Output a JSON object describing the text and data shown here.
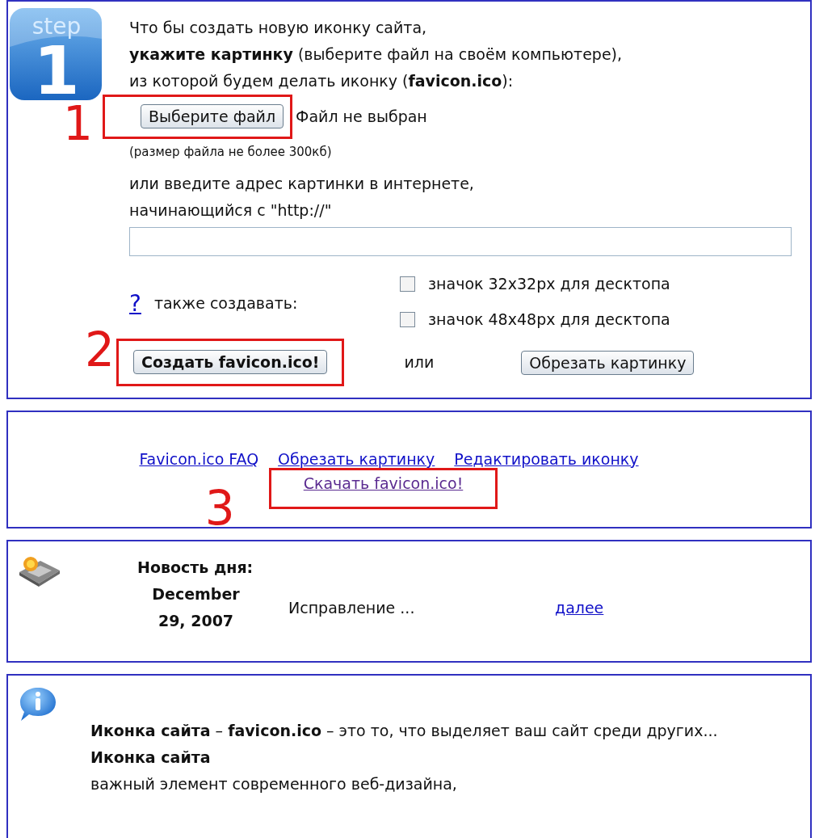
{
  "step_panel": {
    "badge_word": "step",
    "badge_number": "1",
    "intro_lines": [
      "Что бы создать новую иконку сайта,",
      "**укажите картинку** (выберите файл на своём компьютере),",
      "из которой будем делать иконку (**favicon.ico**):"
    ],
    "file_button": "Выберите файл",
    "file_status": "Файл не выбран",
    "size_note": "(размер файла не более 300кб)",
    "url_lines": [
      "или введите адрес картинки в интернете,",
      "начинающийся с \"http://\""
    ],
    "help_link": "?",
    "also_label": "также создавать:",
    "options": [
      {
        "label": "значок 32x32px для десктопа",
        "checked": false
      },
      {
        "label": "значок 48x48px для десктопа",
        "checked": false
      }
    ],
    "create_button": "Создать favicon.ico!",
    "or_text": "или",
    "crop_button": "Обрезать картинку"
  },
  "links_panel": {
    "links": [
      {
        "label": "Favicon.ico FAQ",
        "visited": false
      },
      {
        "label": "Обрезать картинку",
        "visited": false
      },
      {
        "label": "Редактировать иконку",
        "visited": false
      },
      {
        "label": "Скачать favicon.ico!",
        "visited": true
      }
    ]
  },
  "news_panel": {
    "heading": "Новость дня:",
    "date_lines": [
      "December",
      "29, 2007"
    ],
    "summary": "Исправление ...",
    "more_link": "далее"
  },
  "info_panel": {
    "lines": [
      "**Иконка сайта** – **favicon.ico** – это то, что выделяет ваш сайт среди других...",
      "**Иконка сайта**",
      "важный элемент современного веб-дизайна,"
    ]
  },
  "annotations": [
    {
      "label": "1"
    },
    {
      "label": "2"
    },
    {
      "label": "3"
    }
  ]
}
